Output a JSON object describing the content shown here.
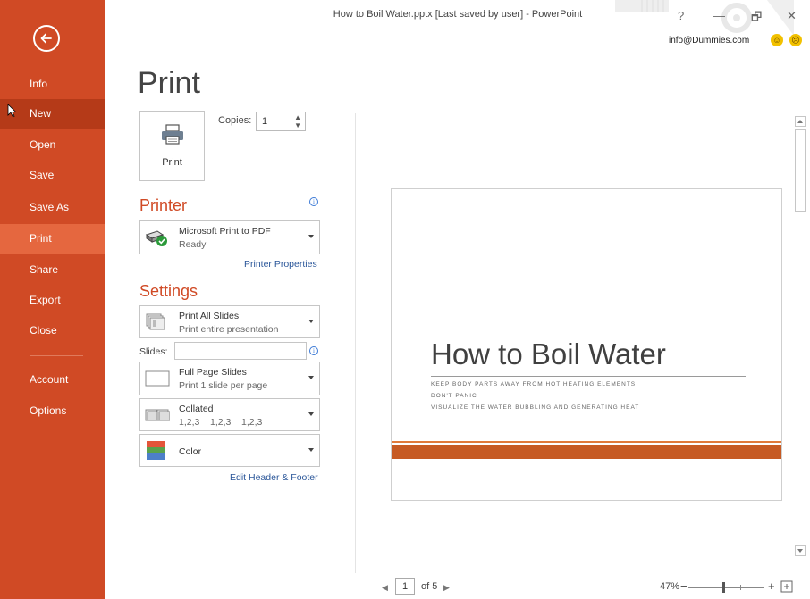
{
  "window": {
    "title": "How to Boil Water.pptx [Last saved by user] - PowerPoint",
    "help": "?",
    "minimize": "—",
    "restore": "🗗",
    "close": "✕",
    "user": "info@Dummies.com",
    "smile": "☺",
    "frown": "☹"
  },
  "nav": {
    "back_icon": "back-arrow-icon",
    "items": [
      {
        "label": "Info"
      },
      {
        "label": "New"
      },
      {
        "label": "Open"
      },
      {
        "label": "Save"
      },
      {
        "label": "Save As"
      },
      {
        "label": "Print"
      },
      {
        "label": "Share"
      },
      {
        "label": "Export"
      },
      {
        "label": "Close"
      },
      {
        "label": "Account"
      },
      {
        "label": "Options"
      }
    ],
    "active": "Print",
    "hovered": "New"
  },
  "print": {
    "title": "Print",
    "button_label": "Print",
    "copies_label": "Copies:",
    "copies_value": "1"
  },
  "printer": {
    "heading": "Printer",
    "name": "Microsoft Print to PDF",
    "status": "Ready",
    "properties_link": "Printer Properties"
  },
  "settings": {
    "heading": "Settings",
    "range": {
      "title": "Print All Slides",
      "subtitle": "Print entire presentation"
    },
    "slides_label": "Slides:",
    "slides_value": "",
    "layout": {
      "title": "Full Page Slides",
      "subtitle": "Print 1 slide per page"
    },
    "collation": {
      "title": "Collated",
      "subtitle": "1,2,3    1,2,3    1,2,3"
    },
    "color": {
      "title": "Color"
    },
    "header_footer_link": "Edit Header & Footer"
  },
  "preview": {
    "slide_title": "How to Boil Water",
    "bullets": [
      "KEEP BODY PARTS AWAY FROM HOT HEATING ELEMENTS",
      "DON'T PANIC",
      "VISUALIZE THE WATER BUBBLING  AND GENERATING HEAT"
    ],
    "accent_color": "#c65a23",
    "current_page": "1",
    "page_of": "of 5",
    "zoom": "47%",
    "zoom_minus": "−",
    "zoom_plus": "+"
  },
  "colors": {
    "nav_bg": "#d04a25",
    "nav_active": "#e5673f",
    "heading": "#d04a25",
    "link": "#2a5699"
  }
}
